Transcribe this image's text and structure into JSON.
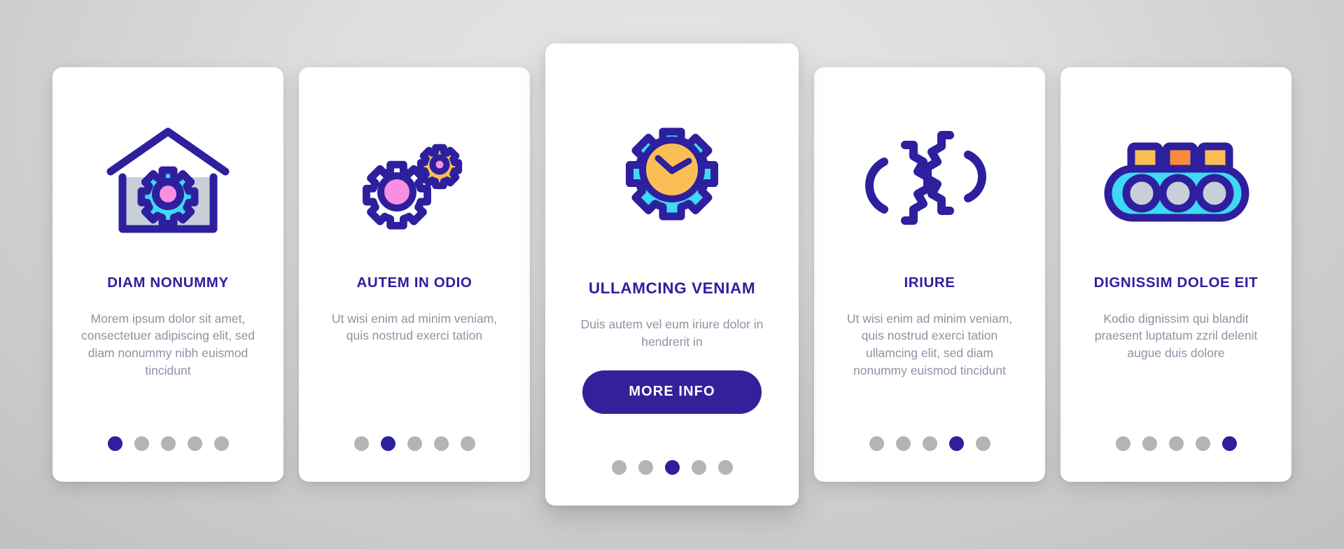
{
  "theme": {
    "page_background": "#dedede",
    "card_background": "#ffffff",
    "title_color": "#2e1f9e",
    "body_color": "#8b94a3",
    "accent_color": "#33219b",
    "dot_inactive_color": "#b4b4b4",
    "dot_active_color": "#2e1f9e",
    "icon_outline": "#2e1f9e",
    "icon_cyan": "#3fd8f5",
    "icon_pink": "#f98fe0",
    "icon_yellow": "#fbbe55",
    "icon_orange": "#f98b3d",
    "icon_gray": "#c8cfd9"
  },
  "total_slides": 5,
  "cards": [
    {
      "id": "card-1",
      "featured": false,
      "icon_name": "house-with-gear-icon",
      "title": "DIAM NONUMMY",
      "body": "Morem ipsum dolor sit amet, consectetuer adipiscing elit, sed diam nonummy nibh euismod tincidunt",
      "active_dot": 1,
      "cta_label": null
    },
    {
      "id": "card-2",
      "featured": false,
      "icon_name": "two-gears-icon",
      "title": "AUTEM IN ODIO",
      "body": "Ut wisi enim ad minim veniam, quis nostrud exerci tation",
      "active_dot": 2,
      "cta_label": null
    },
    {
      "id": "card-3",
      "featured": true,
      "icon_name": "gear-clock-icon",
      "title": "ULLAMCING VENIAM",
      "body": "Duis autem vel eum iriure dolor in hendrerit in",
      "active_dot": 3,
      "cta_label": "MORE INFO"
    },
    {
      "id": "card-4",
      "featured": false,
      "icon_name": "meshing-gears-outline-icon",
      "title": "IRIURE",
      "body": "Ut wisi enim ad minim veniam, quis nostrud exerci tation ullamcing elit, sed diam nonummy euismod tincidunt",
      "active_dot": 4,
      "cta_label": null
    },
    {
      "id": "card-5",
      "featured": false,
      "icon_name": "conveyor-belt-icon",
      "title": "DIGNISSIM DOLOE EIT",
      "body": "Kodio dignissim qui blandit praesent luptatum zzril delenit augue duis dolore",
      "active_dot": 5,
      "cta_label": null
    }
  ]
}
